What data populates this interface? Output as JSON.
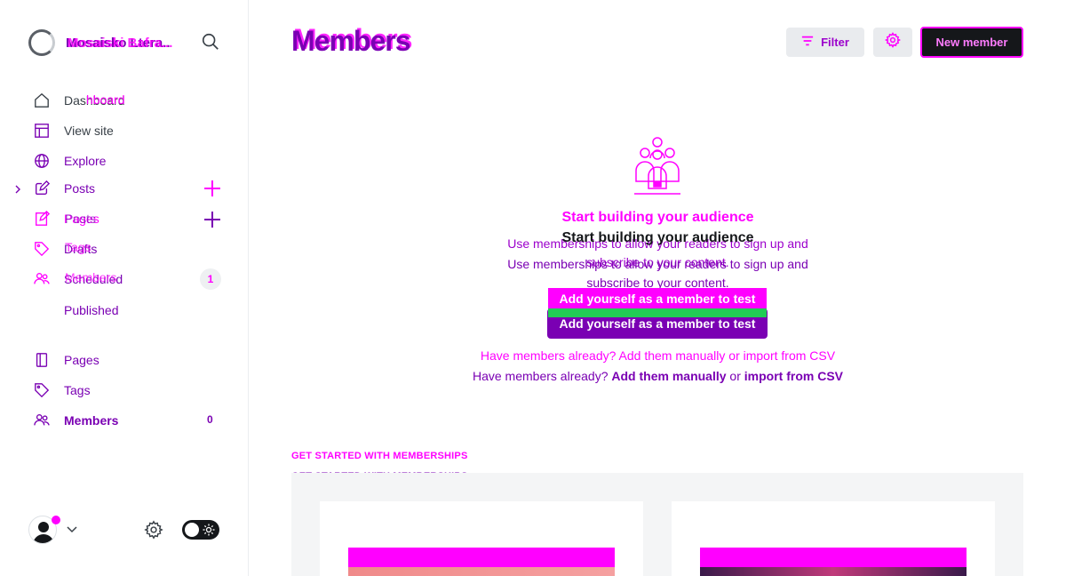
{
  "sidebar": {
    "site_name": "Mosaisko Ltera..",
    "site_name_ghost": "Mosaiski Bafra...",
    "nav": [
      {
        "label": "Dashboard",
        "ghost": "hboard",
        "icon": "home-icon"
      },
      {
        "label": "View site",
        "icon": "layout-icon"
      },
      {
        "label": "Explore",
        "icon": "globe-icon"
      },
      {
        "label": "Posts",
        "icon": "edit-icon"
      },
      {
        "label": "Pages",
        "ghost": "Posts",
        "icon": "edit-icon"
      },
      {
        "label": "Drafts",
        "ghost": "Tags",
        "icon": "tag-icon"
      },
      {
        "label": "Scheduled",
        "ghost": "Members",
        "icon": "members-icon",
        "count": "1"
      },
      {
        "label": "Published"
      },
      {
        "label": "Pages",
        "icon": "pages-icon"
      },
      {
        "label": "Tags",
        "icon": "tag-icon"
      },
      {
        "label": "Members",
        "icon": "members-icon",
        "count": "0"
      }
    ]
  },
  "header": {
    "title": "Members",
    "filter_label": "Filter",
    "new_member_label": "New member"
  },
  "empty_state": {
    "title": "Start building your audience",
    "description": "Use memberships to allow your readers to sign up and subscribe to your content.",
    "cta_label": "Add yourself as a member to test",
    "links_prefix": "Have members already?",
    "link_manual": "Add them manually",
    "links_or": "or",
    "link_csv": "import from CSV"
  },
  "get_started": {
    "label": "GET STARTED WITH MEMBERSHIPS"
  },
  "colors": {
    "accent": "#7a00b3",
    "ghost": "#ff00ff",
    "green": "#22cc55"
  }
}
